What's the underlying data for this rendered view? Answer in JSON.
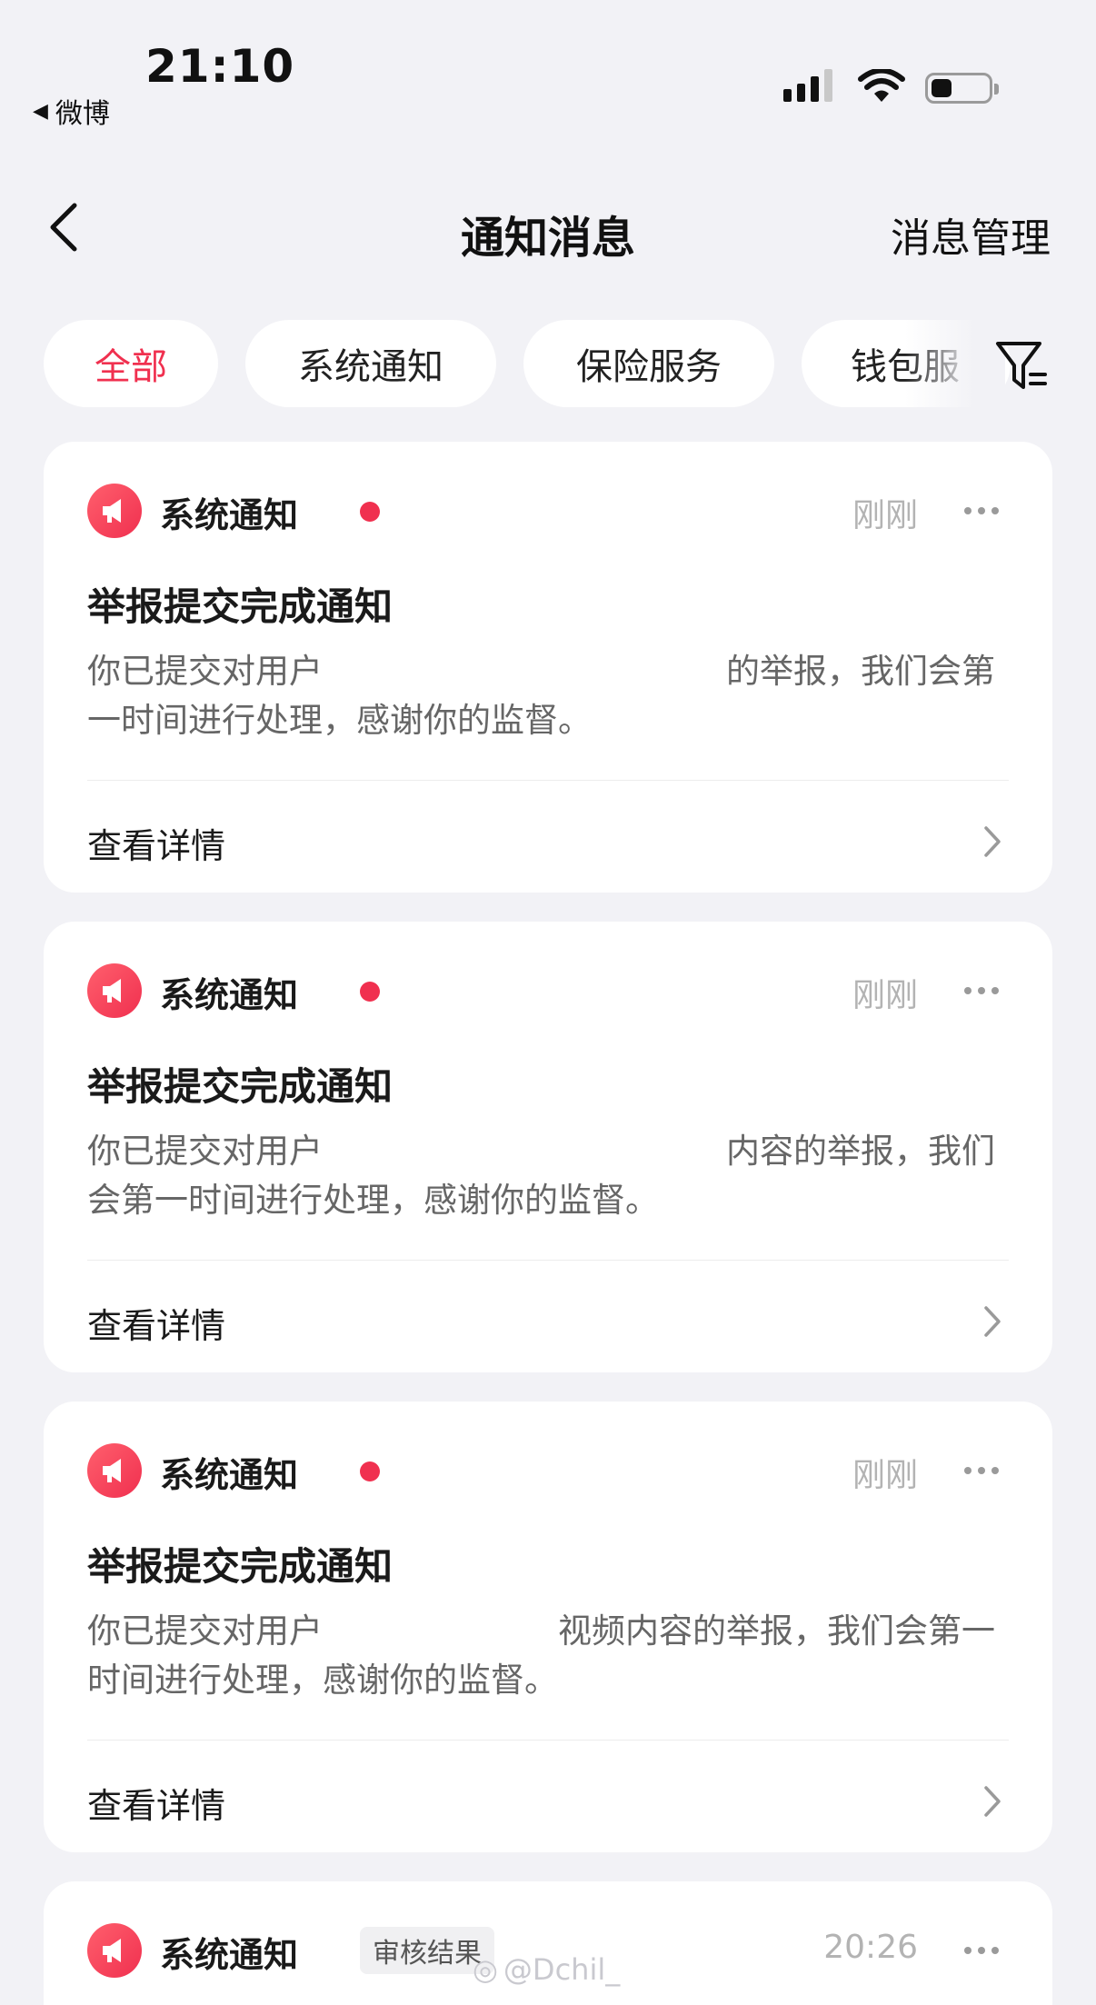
{
  "status_bar": {
    "time": "21:10",
    "back_app": "微博"
  },
  "nav": {
    "title": "通知消息",
    "manage_label": "消息管理"
  },
  "tabs": [
    {
      "label": "全部",
      "active": true
    },
    {
      "label": "系统通知",
      "active": false
    },
    {
      "label": "保险服务",
      "active": false
    },
    {
      "label": "钱包服",
      "active": false
    }
  ],
  "accent_color": "#f0304f",
  "notifications": [
    {
      "source": "系统通知",
      "unread": true,
      "time": "刚刚",
      "title": "举报提交完成通知",
      "body": "你已提交对用户　　　　　　　　　　　　的举报，我们会第一时间进行处理，感谢你的监督。",
      "details_label": "查看详情"
    },
    {
      "source": "系统通知",
      "unread": true,
      "time": "刚刚",
      "title": "举报提交完成通知",
      "body": "你已提交对用户　　　　　　　　　　　　内容的举报，我们会第一时间进行处理，感谢你的监督。",
      "details_label": "查看详情"
    },
    {
      "source": "系统通知",
      "unread": true,
      "time": "刚刚",
      "title": "举报提交完成通知",
      "body": "你已提交对用户　　　　　　　视频内容的举报，我们会第一时间进行处理，感谢你的监督。",
      "details_label": "查看详情"
    },
    {
      "source": "系统通知",
      "badge": "审核结果",
      "time": "20:26"
    }
  ],
  "watermark": "@Dchil_"
}
